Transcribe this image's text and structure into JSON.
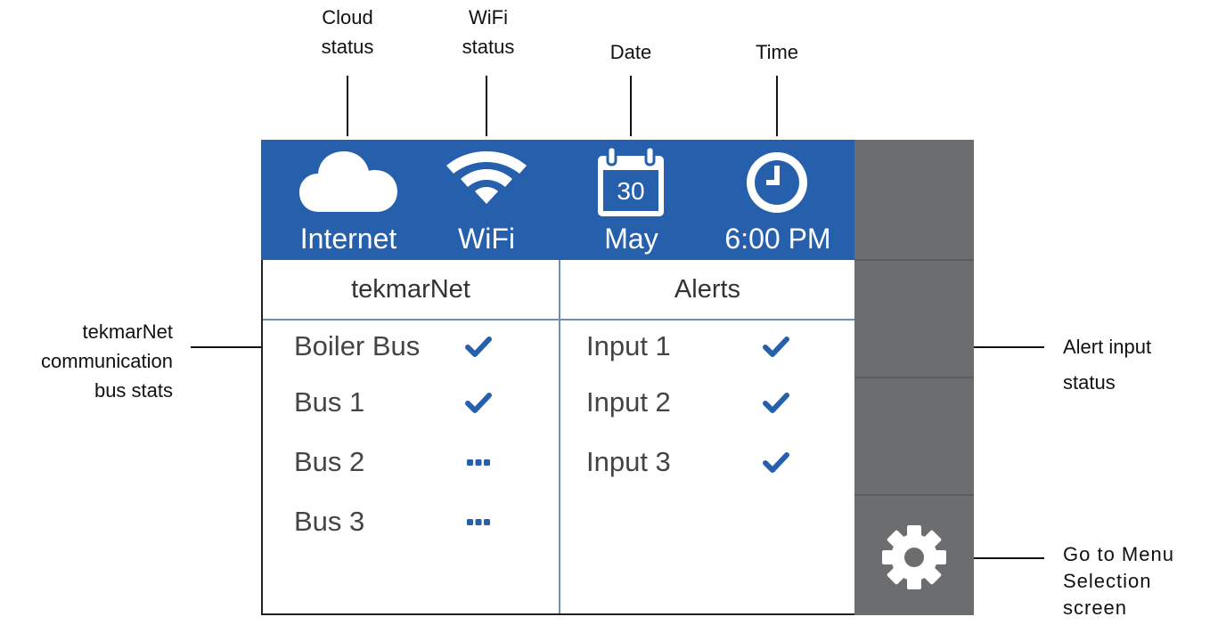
{
  "callouts": {
    "cloud": [
      "Cloud",
      "status"
    ],
    "wifi": [
      "WiFi",
      "status"
    ],
    "date": "Date",
    "time": "Time",
    "tekmarnet": [
      "tekmarNet",
      "communication",
      "bus stats"
    ],
    "alert": [
      "Alert input",
      "status"
    ],
    "menu": [
      "Go to Menu",
      "Selection",
      "screen"
    ]
  },
  "status_bar": {
    "internet_label": "Internet",
    "wifi_label": "WiFi",
    "date_day": "30",
    "date_month": "May",
    "time": "6:00 PM",
    "icons": [
      "cloud-icon",
      "wifi-icon",
      "calendar-icon",
      "clock-icon"
    ]
  },
  "tekmarnet": {
    "title": "tekmarNet",
    "rows": [
      {
        "label": "Boiler Bus",
        "status": "ok"
      },
      {
        "label": "Bus 1",
        "status": "ok"
      },
      {
        "label": "Bus 2",
        "status": "pending"
      },
      {
        "label": "Bus 3",
        "status": "pending"
      }
    ]
  },
  "alerts": {
    "title": "Alerts",
    "rows": [
      {
        "label": "Input 1",
        "status": "ok"
      },
      {
        "label": "Input 2",
        "status": "ok"
      },
      {
        "label": "Input 3",
        "status": "ok"
      }
    ]
  },
  "sidebar": {
    "menu_icon": "gear-icon"
  },
  "colors": {
    "status_bar": "#2660ad",
    "accent": "#2660ad",
    "sidebar": "#6c6d6f",
    "divider": "#6b8fb3"
  }
}
